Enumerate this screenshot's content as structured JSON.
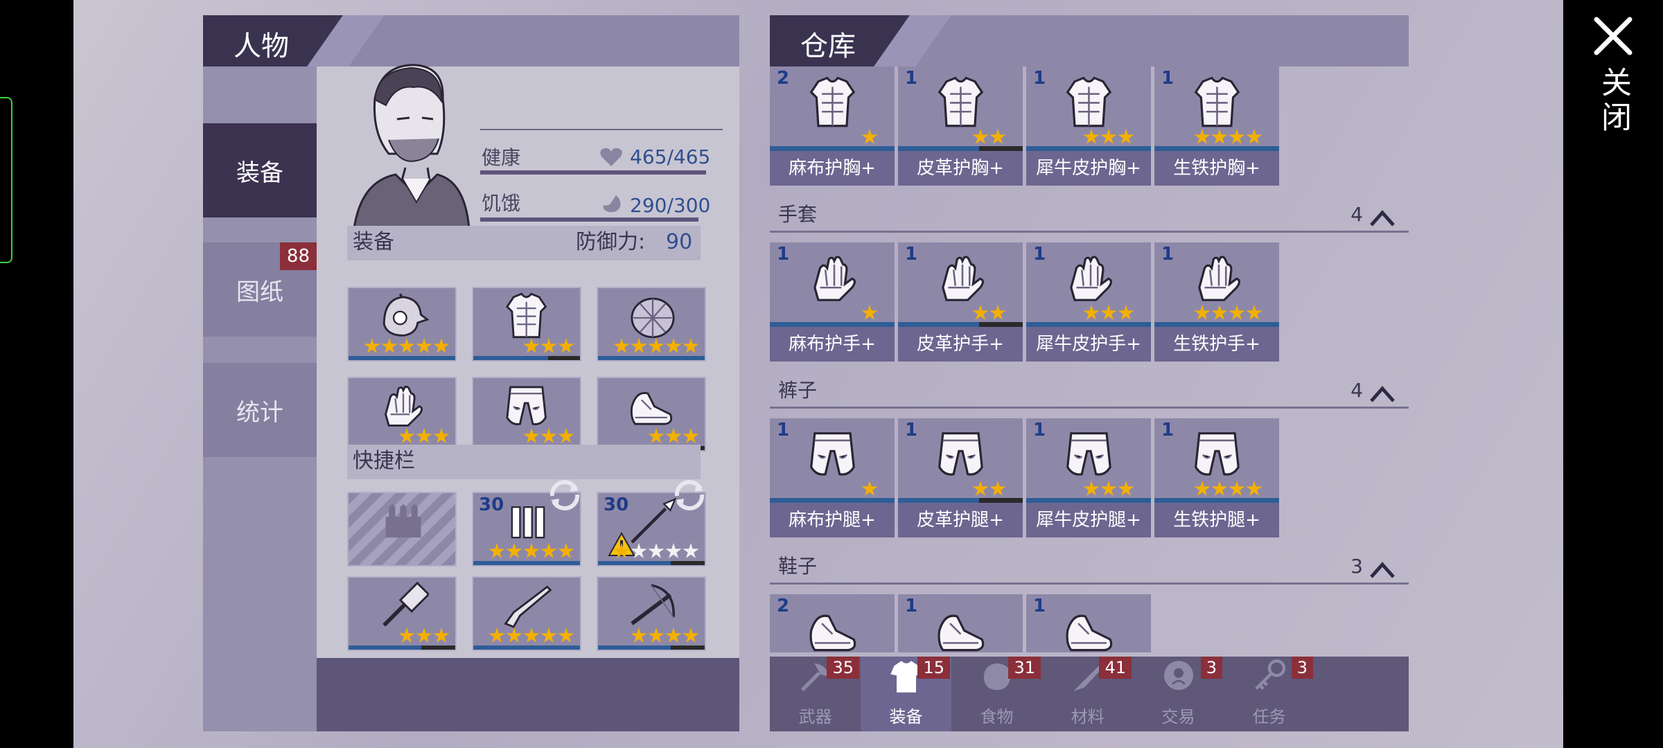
{
  "character_panel": {
    "title": "人物",
    "nav": [
      {
        "label": "装备",
        "active": true
      },
      {
        "label": "图纸",
        "badge": "88"
      },
      {
        "label": "统计"
      }
    ],
    "stats": {
      "health_label": "健康",
      "health_value": "465/465",
      "hunger_label": "饥饿",
      "hunger_value": "290/300"
    },
    "equipment_section": {
      "label": "装备",
      "defense_label": "防御力:",
      "defense_value": "90"
    },
    "equipment_slots": [
      {
        "icon": "helmet-icon",
        "stars": 5
      },
      {
        "icon": "chest-armor-icon",
        "stars": 3
      },
      {
        "icon": "turtle-shell-icon",
        "stars": 5
      },
      {
        "icon": "gloves-icon",
        "stars": 3
      },
      {
        "icon": "pants-icon",
        "stars": 3
      },
      {
        "icon": "shoes-icon",
        "stars": 3
      }
    ],
    "quickbar_label": "快捷栏",
    "quick_slots": [
      {
        "icon": "empty-slot-icon"
      },
      {
        "icon": "ammo-icon",
        "qty": "30",
        "stars": 5
      },
      {
        "icon": "spear-icon",
        "qty": "30",
        "stars": 1,
        "warning": true
      },
      {
        "icon": "hammer-icon",
        "stars": 3
      },
      {
        "icon": "shotgun-icon",
        "stars": 5
      },
      {
        "icon": "crossbow-icon",
        "stars": 4
      }
    ]
  },
  "warehouse_panel": {
    "title": "仓库",
    "rows": [
      {
        "items": [
          {
            "qty": "2",
            "label": "麻布护胸+",
            "stars": 1,
            "icon": "chest-armor-icon"
          },
          {
            "qty": "1",
            "label": "皮革护胸+",
            "stars": 2,
            "icon": "chest-armor-icon"
          },
          {
            "qty": "1",
            "label": "犀牛皮护胸+",
            "stars": 3,
            "icon": "chest-armor-icon"
          },
          {
            "qty": "1",
            "label": "生铁护胸+",
            "stars": 4,
            "icon": "chest-armor-icon"
          }
        ]
      },
      {
        "category": "手套",
        "count": "4",
        "items": [
          {
            "qty": "1",
            "label": "麻布护手+",
            "stars": 1,
            "icon": "gloves-icon"
          },
          {
            "qty": "1",
            "label": "皮革护手+",
            "stars": 2,
            "icon": "gloves-icon"
          },
          {
            "qty": "1",
            "label": "犀牛皮护手+",
            "stars": 3,
            "icon": "gloves-icon"
          },
          {
            "qty": "1",
            "label": "生铁护手+",
            "stars": 4,
            "icon": "gloves-icon"
          }
        ]
      },
      {
        "category": "裤子",
        "count": "4",
        "items": [
          {
            "qty": "1",
            "label": "麻布护腿+",
            "stars": 1,
            "icon": "pants-icon"
          },
          {
            "qty": "1",
            "label": "皮革护腿+",
            "stars": 2,
            "icon": "pants-icon"
          },
          {
            "qty": "1",
            "label": "犀牛皮护腿+",
            "stars": 3,
            "icon": "pants-icon"
          },
          {
            "qty": "1",
            "label": "生铁护腿+",
            "stars": 4,
            "icon": "pants-icon"
          }
        ]
      },
      {
        "category": "鞋子",
        "count": "3",
        "items": [
          {
            "qty": "2",
            "icon": "shoes-icon"
          },
          {
            "qty": "1",
            "icon": "shoes-icon"
          },
          {
            "qty": "1",
            "icon": "shoes-icon"
          }
        ]
      }
    ],
    "tabs": [
      {
        "label": "武器",
        "badge": "35",
        "icon": "axe-icon"
      },
      {
        "label": "装备",
        "badge": "15",
        "icon": "shirt-icon",
        "active": true
      },
      {
        "label": "食物",
        "badge": "31",
        "icon": "food-icon"
      },
      {
        "label": "材料",
        "badge": "41",
        "icon": "material-icon"
      },
      {
        "label": "交易",
        "badge": "3",
        "icon": "coin-icon"
      },
      {
        "label": "任务",
        "badge": "3",
        "icon": "key-icon"
      }
    ]
  },
  "close_label": "关闭"
}
